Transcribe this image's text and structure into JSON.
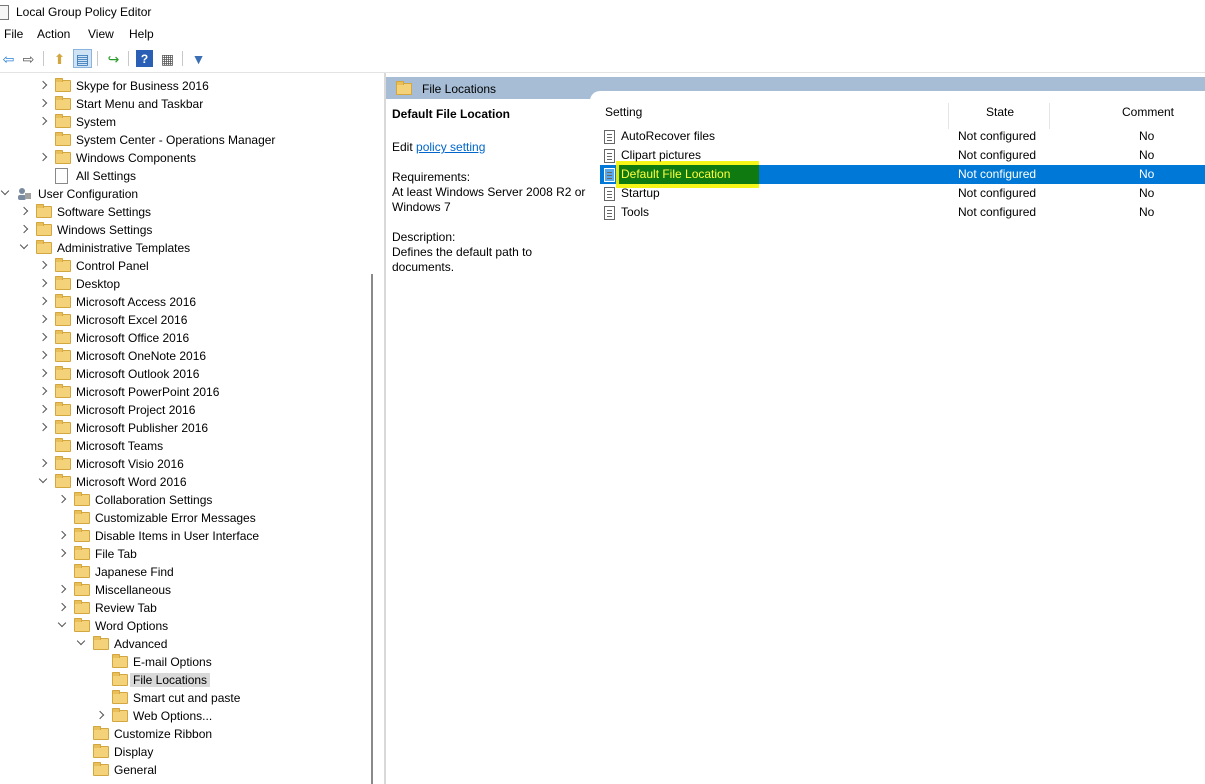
{
  "window": {
    "title": "Local Group Policy Editor"
  },
  "menu": [
    "File",
    "Action",
    "View",
    "Help"
  ],
  "toolbar": [
    {
      "name": "back-arrow-icon",
      "glyph": "⇦"
    },
    {
      "name": "forward-arrow-icon",
      "glyph": "⇨"
    },
    {
      "name": "up-folder-icon",
      "glyph": "⬆"
    },
    {
      "name": "show-hide-tree-icon",
      "glyph": "▤"
    },
    {
      "name": "export-list-icon",
      "glyph": "↪"
    },
    {
      "name": "help-icon",
      "glyph": "?"
    },
    {
      "name": "properties-icon",
      "glyph": "▦"
    },
    {
      "name": "filter-icon",
      "glyph": "▼"
    }
  ],
  "tree": [
    {
      "label": "Skype for Business 2016",
      "depth": 2,
      "exp": "right"
    },
    {
      "label": "Start Menu and Taskbar",
      "depth": 2,
      "exp": "right"
    },
    {
      "label": "System",
      "depth": 2,
      "exp": "right"
    },
    {
      "label": "System Center - Operations Manager",
      "depth": 2,
      "exp": "none"
    },
    {
      "label": "Windows Components",
      "depth": 2,
      "exp": "right"
    },
    {
      "label": "All Settings",
      "depth": 2,
      "exp": "none",
      "icon": "doc"
    },
    {
      "label": "User Configuration",
      "depth": 0,
      "exp": "down",
      "icon": "user"
    },
    {
      "label": "Software Settings",
      "depth": 1,
      "exp": "right"
    },
    {
      "label": "Windows Settings",
      "depth": 1,
      "exp": "right"
    },
    {
      "label": "Administrative Templates",
      "depth": 1,
      "exp": "down"
    },
    {
      "label": "Control Panel",
      "depth": 2,
      "exp": "right"
    },
    {
      "label": "Desktop",
      "depth": 2,
      "exp": "right"
    },
    {
      "label": "Microsoft Access 2016",
      "depth": 2,
      "exp": "right"
    },
    {
      "label": "Microsoft Excel 2016",
      "depth": 2,
      "exp": "right"
    },
    {
      "label": "Microsoft Office 2016",
      "depth": 2,
      "exp": "right"
    },
    {
      "label": "Microsoft OneNote 2016",
      "depth": 2,
      "exp": "right"
    },
    {
      "label": "Microsoft Outlook 2016",
      "depth": 2,
      "exp": "right"
    },
    {
      "label": "Microsoft PowerPoint 2016",
      "depth": 2,
      "exp": "right"
    },
    {
      "label": "Microsoft Project 2016",
      "depth": 2,
      "exp": "right"
    },
    {
      "label": "Microsoft Publisher 2016",
      "depth": 2,
      "exp": "right"
    },
    {
      "label": "Microsoft Teams",
      "depth": 2,
      "exp": "none"
    },
    {
      "label": "Microsoft Visio 2016",
      "depth": 2,
      "exp": "right"
    },
    {
      "label": "Microsoft Word 2016",
      "depth": 2,
      "exp": "down"
    },
    {
      "label": "Collaboration Settings",
      "depth": 3,
      "exp": "right"
    },
    {
      "label": "Customizable Error Messages",
      "depth": 3,
      "exp": "none"
    },
    {
      "label": "Disable Items in User Interface",
      "depth": 3,
      "exp": "right"
    },
    {
      "label": "File Tab",
      "depth": 3,
      "exp": "right"
    },
    {
      "label": "Japanese Find",
      "depth": 3,
      "exp": "none"
    },
    {
      "label": "Miscellaneous",
      "depth": 3,
      "exp": "right"
    },
    {
      "label": "Review Tab",
      "depth": 3,
      "exp": "right"
    },
    {
      "label": "Word Options",
      "depth": 3,
      "exp": "down"
    },
    {
      "label": "Advanced",
      "depth": 4,
      "exp": "down"
    },
    {
      "label": "E-mail Options",
      "depth": 5,
      "exp": "none"
    },
    {
      "label": "File Locations",
      "depth": 5,
      "exp": "none",
      "selected": true
    },
    {
      "label": "Smart cut and paste",
      "depth": 5,
      "exp": "none"
    },
    {
      "label": "Web Options...",
      "depth": 5,
      "exp": "right"
    },
    {
      "label": "Customize Ribbon",
      "depth": 4,
      "exp": "none"
    },
    {
      "label": "Display",
      "depth": 4,
      "exp": "none"
    },
    {
      "label": "General",
      "depth": 4,
      "exp": "none"
    }
  ],
  "banner": {
    "title": "File Locations"
  },
  "description": {
    "title": "Default File Location",
    "edit_prefix": "Edit ",
    "edit_link": "policy setting ",
    "requirements_label": "Requirements:",
    "requirements_text": "At least Windows Server 2008 R2 or Windows 7",
    "description_label": "Description:",
    "description_text": "Defines the default path to documents."
  },
  "list": {
    "columns": [
      "Setting",
      "State",
      "Comment"
    ],
    "rows": [
      {
        "setting": "AutoRecover files",
        "state": "Not configured",
        "comment": "No"
      },
      {
        "setting": "Clipart pictures",
        "state": "Not configured",
        "comment": "No"
      },
      {
        "setting": "Default File Location",
        "state": "Not configured",
        "comment": "No",
        "selected": true
      },
      {
        "setting": "Startup",
        "state": "Not configured",
        "comment": "No"
      },
      {
        "setting": "Tools",
        "state": "Not configured",
        "comment": "No"
      }
    ]
  },
  "colors": {
    "selection": "#0078d7",
    "banner": "#a6bdd5",
    "highlight": "#f5f500",
    "link": "#0066cc"
  }
}
